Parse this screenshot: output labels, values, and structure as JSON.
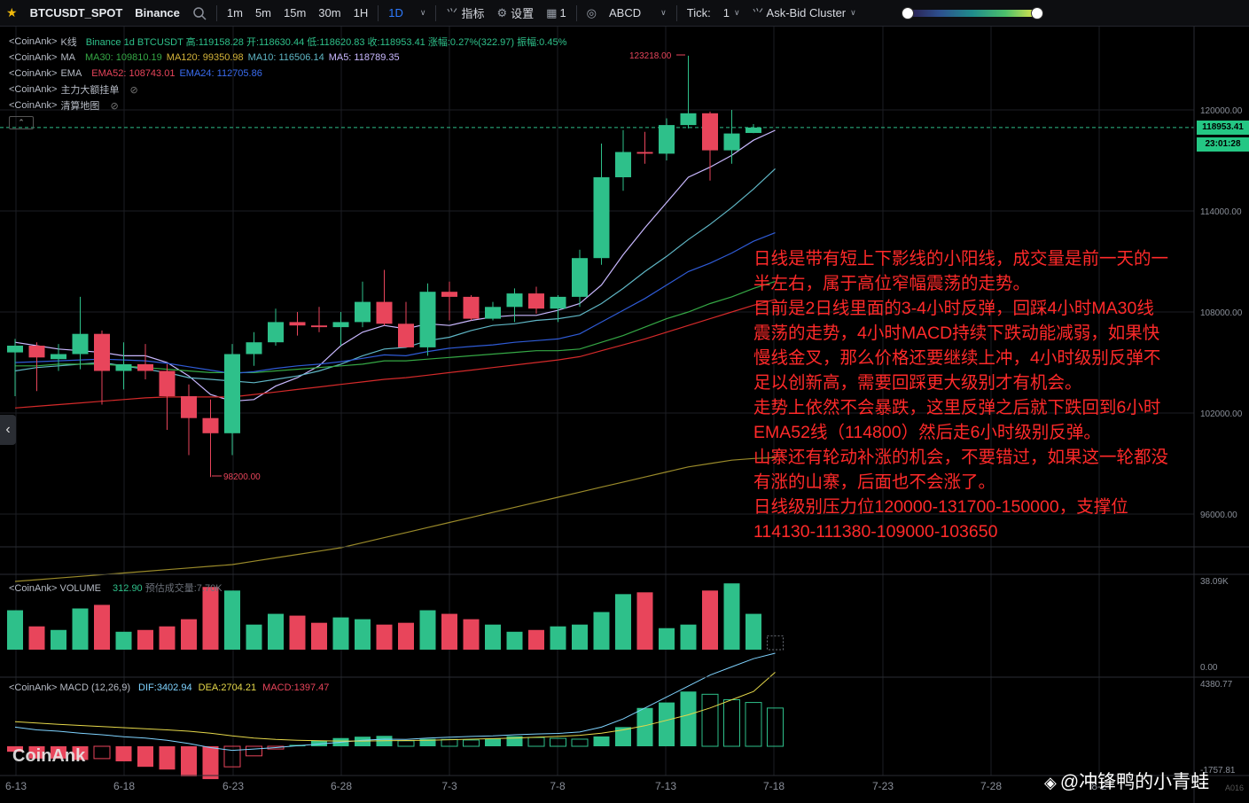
{
  "toolbar": {
    "symbol": "BTCUSDT_SPOT",
    "exchange": "Binance",
    "timeframes": [
      "1m",
      "5m",
      "15m",
      "30m",
      "1H",
      "1D"
    ],
    "active_timeframe": "1D",
    "indicators_label": "指标",
    "settings_label": "设置",
    "layout_label": "1",
    "drawing_label": "ABCD",
    "tick_label": "Tick:",
    "tick_value": "1",
    "cluster_label": "Ask-Bid Cluster"
  },
  "legend": {
    "kline": {
      "src": "<CoinAnk>",
      "name": "K线",
      "text": "Binance 1d BTCUSDT 高:119158.28 开:118630.44 低:118620.83 收:118953.41 涨幅:0.27%(322.97) 振幅:0.45%"
    },
    "ma": {
      "src": "<CoinAnk>",
      "name": "MA",
      "ma30": "MA30: 109810.19",
      "ma120": "MA120: 99350.98",
      "ma10": "MA10: 116506.14",
      "ma5": "MA5: 118789.35"
    },
    "ema": {
      "src": "<CoinAnk>",
      "name": "EMA",
      "ema52": "EMA52: 108743.01",
      "ema24": "EMA24: 112705.86"
    },
    "orders": {
      "src": "<CoinAnk>",
      "name": "主力大额挂单"
    },
    "liq": {
      "src": "<CoinAnk>",
      "name": "清算地图"
    }
  },
  "volume_legend": {
    "src": "<CoinAnk>",
    "name": "VOLUME",
    "value": "312.90",
    "est": "预估成交量:7.70K"
  },
  "macd_legend": {
    "src": "<CoinAnk>",
    "name": "MACD",
    "params": "(12,26,9)",
    "dif": "DIF:3402.94",
    "dea": "DEA:2704.21",
    "macd": "MACD:1397.47"
  },
  "price_tag": "118953.41",
  "time_tag": "23:01:28",
  "high_marker": "123218.00",
  "low_marker": "98200.00",
  "side_arrow": "‹",
  "collapse_glyph": "⌃",
  "watermark": "CoinAnk",
  "credit": "@冲锋鸭的小青蛙",
  "axis_note": "A016",
  "overlay_lines": [
    "日线是带有短上下影线的小阳线，成交量是前一天的一",
    "半左右，属于高位窄幅震荡的走势。",
    "目前是2日线里面的3-4小时反弹，回踩4小时MA30线",
    "震荡的走势，4小时MACD持续下跌动能减弱，如果快",
    "慢线金叉，那么价格还要继续上冲，4小时级别反弹不",
    "足以创新高，需要回踩更大级别才有机会。",
    "走势上依然不会暴跌，这里反弹之后就下跌回到6小时",
    "EMA52线（114800）然后走6小时级别反弹。",
    "山寨还有轮动补涨的机会，不要错过，如果这一轮都没",
    "有涨的山寨，后面也不会涨了。",
    "日线级别压力位120000-131700-150000，支撑位",
    "114130-111380-109000-103650"
  ],
  "colors": {
    "up": "#2ec08a",
    "down": "#e8455b",
    "ma5": "#c9b8ff",
    "ma10": "#5fb6c5",
    "ma30": "#35a845",
    "ma120": "#9a8a2a",
    "ema24": "#2f5bd6",
    "ema52": "#d42a2a",
    "dif": "#7fd3ff",
    "dea": "#e6d84a"
  },
  "chart_data": {
    "type": "candlestick",
    "price_axis": {
      "ticks": [
        120000,
        114000,
        108000,
        102000,
        96000
      ],
      "tick_labels": [
        "120000.00",
        "114000.00",
        "108000.00",
        "102000.00",
        "96000.00"
      ]
    },
    "volume_axis": {
      "ticks": [
        38090,
        0
      ],
      "tick_labels": [
        "38.09K",
        "0.00"
      ]
    },
    "macd_axis": {
      "ticks": [
        4380.77,
        -1757.81
      ],
      "tick_labels": [
        "4380.77",
        "-1757.81"
      ]
    },
    "x_labels": [
      "6-13",
      "6-18",
      "6-23",
      "6-28",
      "7-3",
      "7-8",
      "7-13",
      "7-18",
      "7-23",
      "7-28",
      "8-2"
    ],
    "candles": [
      {
        "o": 105600,
        "h": 106400,
        "l": 103000,
        "c": 106000
      },
      {
        "o": 106000,
        "h": 106200,
        "l": 103300,
        "c": 105300
      },
      {
        "o": 105200,
        "h": 106100,
        "l": 104500,
        "c": 105500
      },
      {
        "o": 105500,
        "h": 108900,
        "l": 104600,
        "c": 106700
      },
      {
        "o": 106700,
        "h": 106900,
        "l": 102500,
        "c": 104500
      },
      {
        "o": 104500,
        "h": 106200,
        "l": 103400,
        "c": 104900
      },
      {
        "o": 104900,
        "h": 106100,
        "l": 104000,
        "c": 104500
      },
      {
        "o": 104500,
        "h": 104900,
        "l": 101000,
        "c": 103000
      },
      {
        "o": 103000,
        "h": 103700,
        "l": 99500,
        "c": 101700
      },
      {
        "o": 101700,
        "h": 102800,
        "l": 98200,
        "c": 100800
      },
      {
        "o": 100800,
        "h": 106100,
        "l": 99500,
        "c": 105500
      },
      {
        "o": 105500,
        "h": 106800,
        "l": 104800,
        "c": 106200
      },
      {
        "o": 106200,
        "h": 108200,
        "l": 106000,
        "c": 107400
      },
      {
        "o": 107400,
        "h": 108000,
        "l": 106600,
        "c": 107200
      },
      {
        "o": 107200,
        "h": 108300,
        "l": 106800,
        "c": 107100
      },
      {
        "o": 107100,
        "h": 108000,
        "l": 106000,
        "c": 107400
      },
      {
        "o": 107400,
        "h": 109800,
        "l": 107100,
        "c": 108600
      },
      {
        "o": 108600,
        "h": 110500,
        "l": 107200,
        "c": 107300
      },
      {
        "o": 107300,
        "h": 108600,
        "l": 105900,
        "c": 105900
      },
      {
        "o": 105900,
        "h": 109700,
        "l": 105400,
        "c": 109200
      },
      {
        "o": 109200,
        "h": 109800,
        "l": 107500,
        "c": 108900
      },
      {
        "o": 108900,
        "h": 109000,
        "l": 107500,
        "c": 107600
      },
      {
        "o": 107600,
        "h": 108600,
        "l": 107500,
        "c": 108300
      },
      {
        "o": 108300,
        "h": 109400,
        "l": 107400,
        "c": 109100
      },
      {
        "o": 109100,
        "h": 109500,
        "l": 107900,
        "c": 108200
      },
      {
        "o": 108200,
        "h": 109000,
        "l": 107400,
        "c": 108900
      },
      {
        "o": 108900,
        "h": 111700,
        "l": 108300,
        "c": 111200
      },
      {
        "o": 111200,
        "h": 118000,
        "l": 110800,
        "c": 116000
      },
      {
        "o": 116000,
        "h": 118800,
        "l": 115200,
        "c": 117500
      },
      {
        "o": 117500,
        "h": 118700,
        "l": 116800,
        "c": 117400
      },
      {
        "o": 117400,
        "h": 119500,
        "l": 117000,
        "c": 119100
      },
      {
        "o": 119100,
        "h": 123218,
        "l": 118900,
        "c": 119800
      },
      {
        "o": 119800,
        "h": 119900,
        "l": 115800,
        "c": 117600
      },
      {
        "o": 117600,
        "h": 120000,
        "l": 116800,
        "c": 118600
      },
      {
        "o": 118630,
        "h": 119158,
        "l": 118620,
        "c": 118953
      }
    ],
    "volume": [
      22000,
      13000,
      11000,
      23000,
      25000,
      10000,
      11000,
      13000,
      17000,
      35000,
      33000,
      14000,
      20000,
      19000,
      15000,
      18000,
      17000,
      14000,
      15000,
      22000,
      20000,
      17000,
      14000,
      10000,
      11000,
      13000,
      14000,
      21000,
      31000,
      32000,
      12000,
      14000,
      33000,
      37000,
      20000,
      7700
    ],
    "macd_hist": [
      -200,
      -450,
      -450,
      -500,
      -450,
      -550,
      -750,
      -850,
      -1100,
      -1200,
      -750,
      -350,
      -100,
      50,
      200,
      300,
      350,
      380,
      200,
      270,
      250,
      230,
      280,
      370,
      320,
      290,
      260,
      360,
      700,
      1400,
      1600,
      2000,
      1900,
      1700,
      1600,
      1397
    ],
    "ma": {
      "ma5": [
        106200,
        106000,
        105800,
        105700,
        105600,
        105400,
        105400,
        105000,
        104200,
        103100,
        102700,
        102800,
        103600,
        104100,
        104800,
        106000,
        106800,
        107200,
        107000,
        107300,
        107200,
        107500,
        107700,
        107800,
        107800,
        108100,
        108500,
        109600,
        111400,
        113000,
        114500,
        116000,
        116600,
        117300,
        118200,
        118789
      ],
      "ma10": [
        104500,
        104700,
        104800,
        104900,
        105000,
        104800,
        104600,
        104400,
        104100,
        104000,
        103900,
        103800,
        104000,
        104200,
        104500,
        104900,
        105400,
        105800,
        105900,
        106300,
        106500,
        106900,
        107200,
        107300,
        107500,
        107600,
        107800,
        108500,
        109400,
        110400,
        111300,
        112300,
        113200,
        114200,
        115300,
        116506
      ],
      "ma30": [
        104800,
        104800,
        104900,
        104900,
        104900,
        104800,
        104700,
        104600,
        104500,
        104400,
        104400,
        104400,
        104500,
        104600,
        104700,
        104800,
        104900,
        105100,
        105100,
        105200,
        105300,
        105400,
        105500,
        105600,
        105700,
        105700,
        105800,
        106200,
        106600,
        107100,
        107600,
        108000,
        108500,
        108900,
        109400,
        109810
      ],
      "ma120": [
        92000,
        92100,
        92200,
        92300,
        92400,
        92500,
        92600,
        92700,
        92800,
        92900,
        93000,
        93200,
        93400,
        93600,
        93800,
        94000,
        94300,
        94600,
        94900,
        95200,
        95500,
        95800,
        96100,
        96400,
        96700,
        97000,
        97300,
        97600,
        97900,
        98200,
        98500,
        98800,
        99000,
        99200,
        99300,
        99351
      ],
      "ema24": [
        105000,
        105050,
        105100,
        105150,
        105200,
        105150,
        105100,
        104950,
        104750,
        104550,
        104350,
        104450,
        104650,
        104800,
        104900,
        105050,
        105250,
        105450,
        105400,
        105650,
        105850,
        105950,
        106050,
        106200,
        106300,
        106400,
        106700,
        107400,
        108100,
        108800,
        109600,
        110400,
        110900,
        111500,
        112200,
        112706
      ],
      "ema52": [
        102300,
        102400,
        102500,
        102600,
        102700,
        102800,
        102900,
        102950,
        102950,
        102950,
        102950,
        103100,
        103250,
        103400,
        103550,
        103700,
        103850,
        104000,
        104100,
        104250,
        104400,
        104550,
        104700,
        104850,
        105000,
        105150,
        105350,
        105700,
        106050,
        106400,
        106800,
        107200,
        107600,
        108000,
        108400,
        108743
      ]
    },
    "dif": [
      700,
      600,
      550,
      480,
      420,
      350,
      300,
      220,
      100,
      -50,
      -150,
      -100,
      -50,
      20,
      80,
      150,
      220,
      260,
      250,
      300,
      330,
      360,
      380,
      420,
      450,
      470,
      520,
      700,
      1000,
      1400,
      1800,
      2200,
      2600,
      2900,
      3200,
      3400
    ],
    "dea": [
      900,
      850,
      800,
      760,
      720,
      680,
      640,
      600,
      550,
      480,
      380,
      300,
      250,
      220,
      200,
      190,
      190,
      200,
      210,
      220,
      240,
      260,
      280,
      300,
      330,
      360,
      400,
      480,
      600,
      750,
      950,
      1150,
      1400,
      1700,
      2000,
      2704
    ]
  }
}
